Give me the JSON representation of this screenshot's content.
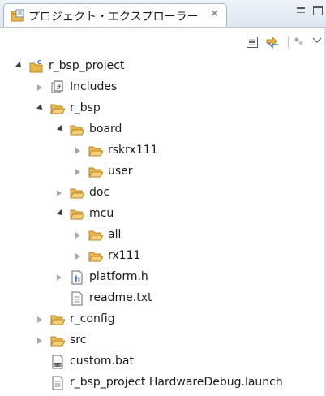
{
  "view": {
    "title": "プロジェクト・エクスプローラー",
    "close_glyph": "✕"
  },
  "tree": {
    "items": [
      {
        "label": "r_bsp_project",
        "depth": 0,
        "state": "expanded",
        "icon": "c-project-icon"
      },
      {
        "label": "Includes",
        "depth": 1,
        "state": "collapsed",
        "icon": "includes-icon"
      },
      {
        "label": "r_bsp",
        "depth": 1,
        "state": "expanded",
        "icon": "folder-icon"
      },
      {
        "label": "board",
        "depth": 2,
        "state": "expanded",
        "icon": "folder-icon"
      },
      {
        "label": "rskrx111",
        "depth": 3,
        "state": "collapsed",
        "icon": "folder-icon"
      },
      {
        "label": "user",
        "depth": 3,
        "state": "collapsed",
        "icon": "folder-icon"
      },
      {
        "label": "doc",
        "depth": 2,
        "state": "collapsed",
        "icon": "folder-icon"
      },
      {
        "label": "mcu",
        "depth": 2,
        "state": "expanded",
        "icon": "folder-icon"
      },
      {
        "label": "all",
        "depth": 3,
        "state": "collapsed",
        "icon": "folder-icon"
      },
      {
        "label": "rx111",
        "depth": 3,
        "state": "collapsed",
        "icon": "folder-icon"
      },
      {
        "label": "platform.h",
        "depth": 2,
        "state": "collapsed",
        "icon": "header-file-icon"
      },
      {
        "label": "readme.txt",
        "depth": 2,
        "state": "none",
        "icon": "text-file-icon"
      },
      {
        "label": "r_config",
        "depth": 1,
        "state": "collapsed",
        "icon": "folder-icon"
      },
      {
        "label": "src",
        "depth": 1,
        "state": "collapsed",
        "icon": "folder-icon"
      },
      {
        "label": "custom.bat",
        "depth": 1,
        "state": "none",
        "icon": "binary-file-icon"
      },
      {
        "label": "r_bsp_project HardwareDebug.launch",
        "depth": 1,
        "state": "none",
        "icon": "text-file-icon"
      }
    ]
  },
  "colors": {
    "folder": "#e8b84a",
    "folder_dark": "#b8862a",
    "accent": "#3b6db3"
  }
}
